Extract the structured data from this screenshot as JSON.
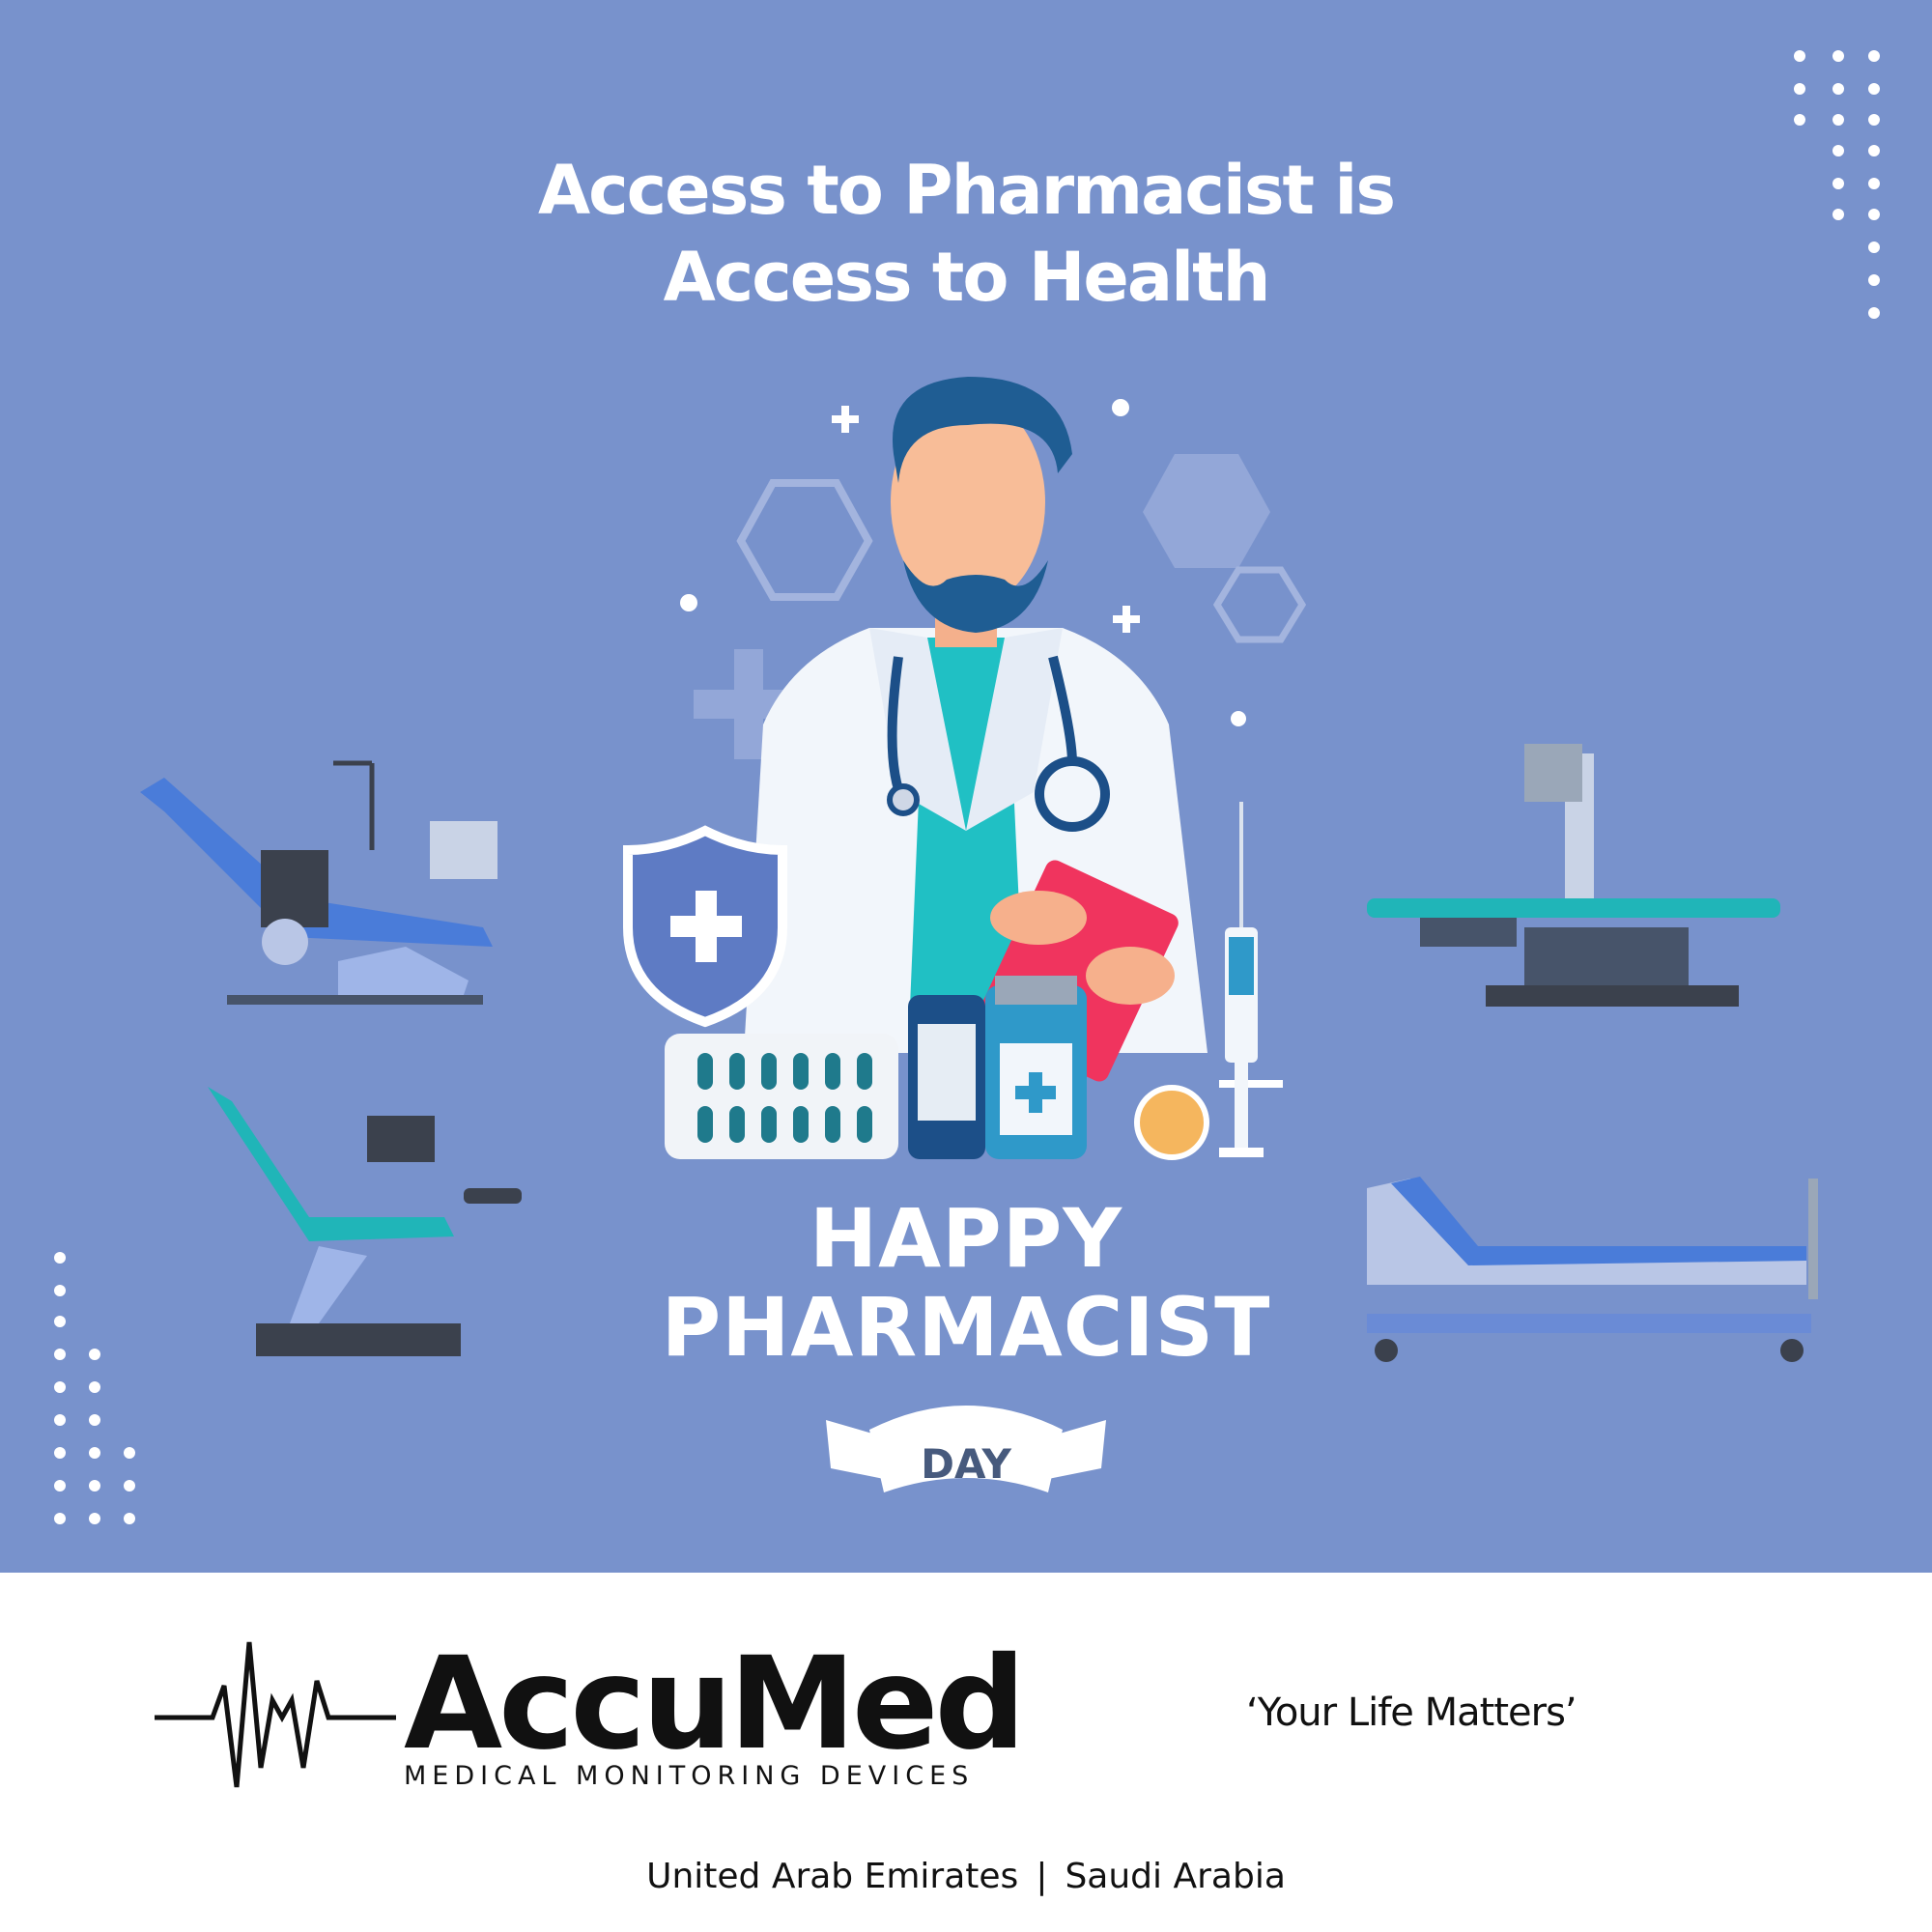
{
  "headline": {
    "line1": "Access to Pharmacist is",
    "line2": "Access to Health"
  },
  "greeting": {
    "line1": "HAPPY",
    "line2": "PHARMACIST",
    "ribbon_text": "DAY"
  },
  "brand": {
    "name": "AccuMed",
    "subtitle": "MEDICAL MONITORING DEVICES",
    "tagline": "‘Your Life Matters’"
  },
  "locations": {
    "first": "United Arab Emirates",
    "separator": "|",
    "second": "Saudi Arabia"
  },
  "colors": {
    "background": "#7892cc",
    "footer": "#ffffff",
    "text_light": "#ffffff",
    "text_dark": "#111111",
    "teal": "#20b5b8",
    "navy": "#1c4f88",
    "red_clipboard": "#f0345e"
  },
  "icons": [
    "ecg-heartbeat-icon",
    "shield-plus-icon",
    "stethoscope-icon",
    "syringe-icon",
    "pill-blister-icon",
    "medicine-bottle-icon"
  ]
}
